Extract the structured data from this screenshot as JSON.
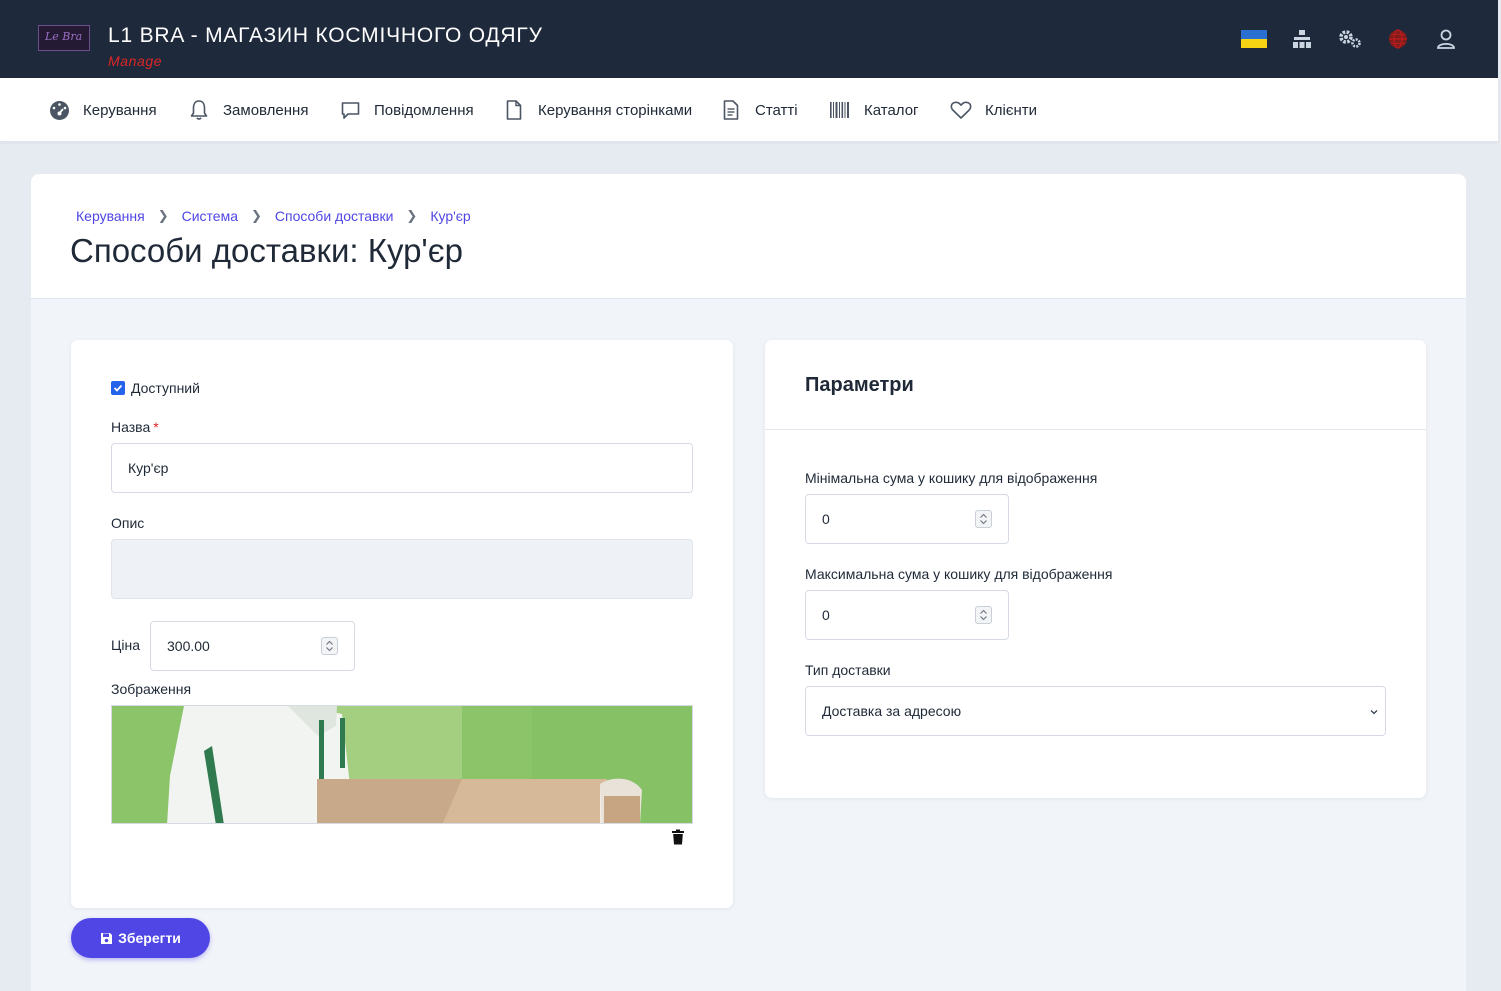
{
  "header": {
    "logo_text": "Le Bra",
    "title": "L1 BRA - МАГАЗИН КОСМІЧНОГО ОДЯГУ",
    "subtitle": "Manage",
    "icons": [
      "ukraine-flag-icon",
      "hierarchy-icon",
      "gears-icon",
      "globe-icon",
      "user-icon"
    ]
  },
  "menu": {
    "items": [
      {
        "label": "Керування",
        "icon": "dashboard-icon"
      },
      {
        "label": "Замовлення",
        "icon": "bell-icon"
      },
      {
        "label": "Повідомлення",
        "icon": "chat-icon"
      },
      {
        "label": "Керування сторінками",
        "icon": "page-icon"
      },
      {
        "label": "Статті",
        "icon": "document-icon"
      },
      {
        "label": "Каталог",
        "icon": "barcode-icon"
      },
      {
        "label": "Клієнти",
        "icon": "heart-icon"
      }
    ]
  },
  "breadcrumb": [
    "Керування",
    "Система",
    "Способи доставки",
    "Кур'єр"
  ],
  "page_title": "Способи доставки: Кур'єр",
  "form": {
    "available_label": "Доступний",
    "available_checked": true,
    "name_label": "Назва",
    "name_required_mark": "*",
    "name_value": "Кур'єр",
    "description_label": "Опис",
    "description_value": "",
    "price_label": "Ціна",
    "price_value": "300.00",
    "image_label": "Зображення"
  },
  "params": {
    "title": "Параметри",
    "min_label": "Мінімальна сума у кошику для відображення",
    "min_value": "0",
    "max_label": "Максимальна сума у кошику для відображення",
    "max_value": "0",
    "type_label": "Тип доставки",
    "type_value": "Доставка за адресою"
  },
  "save_label": "Зберегти",
  "colors": {
    "header_bg": "#1e293b",
    "accent": "#4f46e5",
    "danger": "#dc2626",
    "page_bg": "#e6eaf1"
  }
}
